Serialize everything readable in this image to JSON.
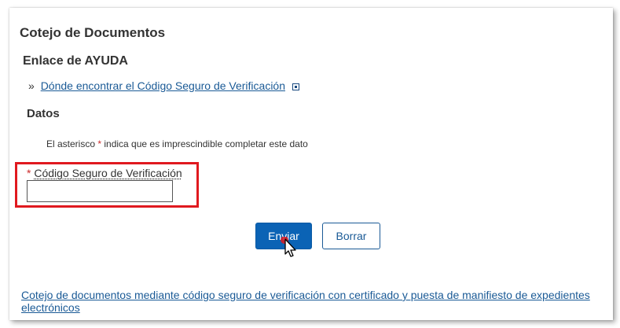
{
  "page": {
    "title": "Cotejo de Documentos"
  },
  "help": {
    "heading": "Enlace de AYUDA",
    "bullet": "»",
    "link_text": "Dónde encontrar el Código Seguro de Verificación",
    "link_icon": "external-link-icon"
  },
  "datos": {
    "heading": "Datos",
    "note_before": "El asterisco ",
    "note_asterisk": "*",
    "note_after": " indica que es imprescindible completar este dato"
  },
  "form": {
    "required_mark": "*",
    "field_label": "Código Seguro de Verificación",
    "field_value": "",
    "submit_label": "Enviar",
    "reset_label": "Borrar"
  },
  "footer": {
    "link_text": "Cotejo de documentos mediante código seguro de verificación con certificado y puesta de manifiesto de expedientes electrónicos"
  },
  "colors": {
    "primary": "#0b63b5",
    "link": "#1a5a96",
    "required": "#cc2b2b",
    "highlight": "#e0191f"
  }
}
